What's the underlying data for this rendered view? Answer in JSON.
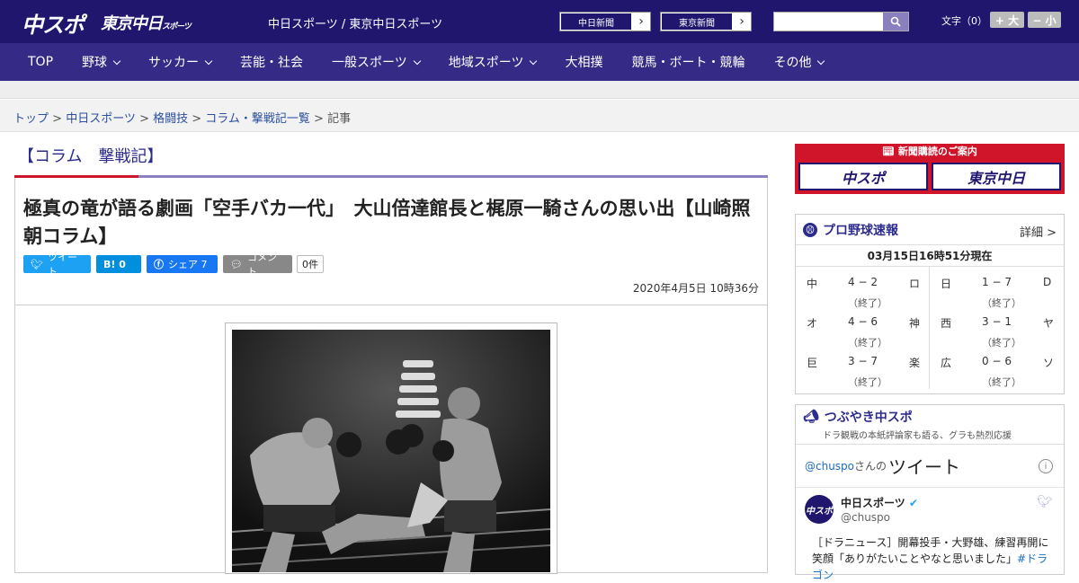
{
  "header": {
    "logo_chuspo": "中スポ",
    "logo_tokyo": "東京中日",
    "logo_tokyo_small": "スポーツ",
    "site_name": "中日スポーツ / 東京中日スポーツ",
    "btn_chunichi": "中日新聞",
    "btn_tokyo": "東京新聞",
    "search_placeholder": "",
    "fontsize_label": "文字（0）",
    "font_up": "+ 大",
    "font_down": "− 小"
  },
  "nav": [
    "TOP",
    "野球",
    "サッカー",
    "芸能・社会",
    "一般スポーツ",
    "地域スポーツ",
    "大相撲",
    "競馬・ボート・競輪",
    "その他"
  ],
  "breadcrumb": {
    "items": [
      "トップ",
      "中日スポーツ",
      "格闘技",
      "コラム・撃戦記一覧"
    ],
    "current": "記事"
  },
  "section_title": "【コラム　撃戦記】",
  "article": {
    "title": "極真の竜が語る劇画「空手バカ一代」　大山倍達館長と梶原一騎さんの思い出【山崎照朝コラム】",
    "share": {
      "tweet": "ツイート",
      "hatena": "B! 0",
      "facebook": "シェア 7",
      "comment": "コメント",
      "count": "0件"
    },
    "date": "2020年4月5日 10時36分"
  },
  "sidebar": {
    "ad_head": "新聞購読のご案内",
    "ad_logo1": "中スポ",
    "ad_logo2": "東京中日",
    "baseball": {
      "title": "プロ野球速報",
      "more": "詳細 >",
      "asof": "03月15日16時51分現在",
      "left": [
        {
          "t1": "中",
          "score": "4 − 2",
          "t2": "ロ",
          "status": "（終了）"
        },
        {
          "t1": "オ",
          "score": "4 − 6",
          "t2": "神",
          "status": "（終了）"
        },
        {
          "t1": "巨",
          "score": "3 − 7",
          "t2": "楽",
          "status": "（終了）"
        }
      ],
      "right": [
        {
          "t1": "日",
          "score": "1 − 7",
          "t2": "D",
          "status": "（終了）"
        },
        {
          "t1": "西",
          "score": "3 − 1",
          "t2": "ヤ",
          "status": "（終了）"
        },
        {
          "t1": "広",
          "score": "0 − 6",
          "t2": "ソ",
          "status": "（終了）"
        }
      ]
    },
    "twitter": {
      "title": "つぶやき中スポ",
      "sub": "ドラ観戦の本紙評論家も語る、グラも熱烈応援",
      "handle_prefix": "@chuspo",
      "handle_suffix": "さんの",
      "heading": "ツイート",
      "name": "中日スポーツ",
      "handle": "@chuspo",
      "avatar": "中スポ",
      "text": "［ドラニュース］開幕投手・大野雄、練習再開に笑顔「ありがたいことやなと思いました」",
      "hashtag": "#ドラゴン"
    }
  }
}
